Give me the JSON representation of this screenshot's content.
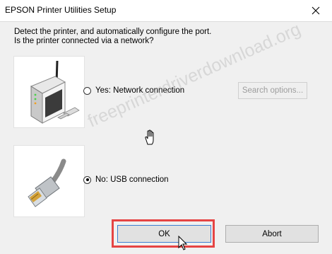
{
  "window": {
    "title": "EPSON Printer Utilities Setup",
    "close_icon": "close-icon"
  },
  "prompt": {
    "line1": "Detect the printer, and automatically configure the port.",
    "line2": "Is the printer connected via a network?"
  },
  "options": {
    "network": {
      "label": "Yes: Network connection",
      "checked": false,
      "icon": "network-printer-icon"
    },
    "usb": {
      "label": "No: USB connection",
      "checked": true,
      "icon": "usb-cable-icon"
    }
  },
  "buttons": {
    "search_options": "Search options...",
    "ok": "OK",
    "abort": "Abort"
  },
  "watermark": "freeprinterdriverdownload.org",
  "colors": {
    "highlight": "#e54444",
    "focus_border": "#3c7fd1",
    "disabled_text": "#9d9d9d"
  }
}
